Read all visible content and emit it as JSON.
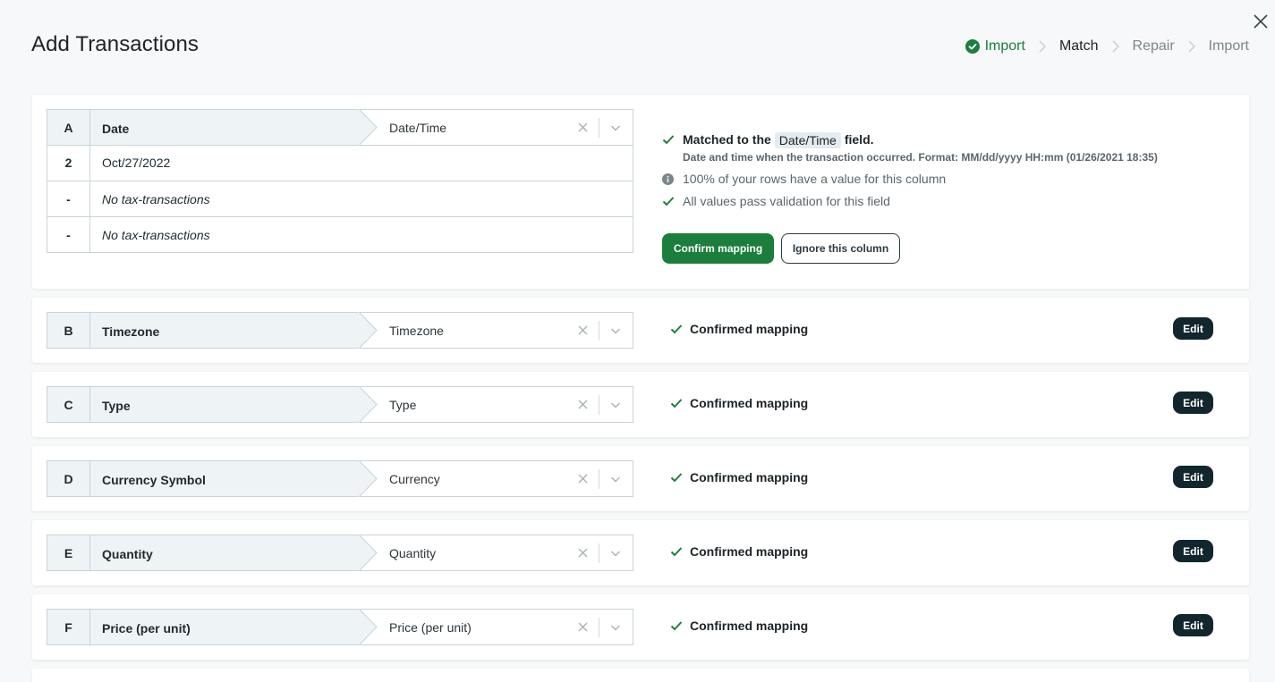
{
  "header": {
    "title": "Add Transactions"
  },
  "stepper": {
    "steps": [
      {
        "label": "Import",
        "state": "done"
      },
      {
        "label": "Match",
        "state": "active"
      },
      {
        "label": "Repair",
        "state": "pending"
      },
      {
        "label": "Import",
        "state": "pending"
      }
    ]
  },
  "colors": {
    "accent_green": "#1b7e3c",
    "edit_button": "#12262e",
    "header_cell_bg": "#eef3f6"
  },
  "expanded": {
    "letter": "A",
    "column_name": "Date",
    "field": "Date/Time",
    "rows": [
      {
        "num": "2",
        "value": "Oct/27/2022",
        "italic": false
      },
      {
        "num": "-",
        "value": "No tax-transactions",
        "italic": true
      },
      {
        "num": "-",
        "value": "No tax-transactions",
        "italic": true
      }
    ],
    "match_prefix": "Matched to the",
    "match_field": "Date/Time",
    "match_suffix": "field.",
    "description": "Date and time when the transaction occurred. Format: MM/dd/yyyy HH:mm (01/26/2021 18:35)",
    "info_line": "100% of your rows have a value for this column",
    "valid_line": "All values pass validation for this field",
    "confirm_label": "Confirm mapping",
    "ignore_label": "Ignore this column"
  },
  "mappings": [
    {
      "letter": "B",
      "column_name": "Timezone",
      "field": "Timezone",
      "status": "Confirmed mapping",
      "edit_label": "Edit"
    },
    {
      "letter": "C",
      "column_name": "Type",
      "field": "Type",
      "status": "Confirmed mapping",
      "edit_label": "Edit"
    },
    {
      "letter": "D",
      "column_name": "Currency Symbol",
      "field": "Currency",
      "status": "Confirmed mapping",
      "edit_label": "Edit"
    },
    {
      "letter": "E",
      "column_name": "Quantity",
      "field": "Quantity",
      "status": "Confirmed mapping",
      "edit_label": "Edit"
    },
    {
      "letter": "F",
      "column_name": "Price (per unit)",
      "field": "Price (per unit)",
      "status": "Confirmed mapping",
      "edit_label": "Edit"
    }
  ]
}
